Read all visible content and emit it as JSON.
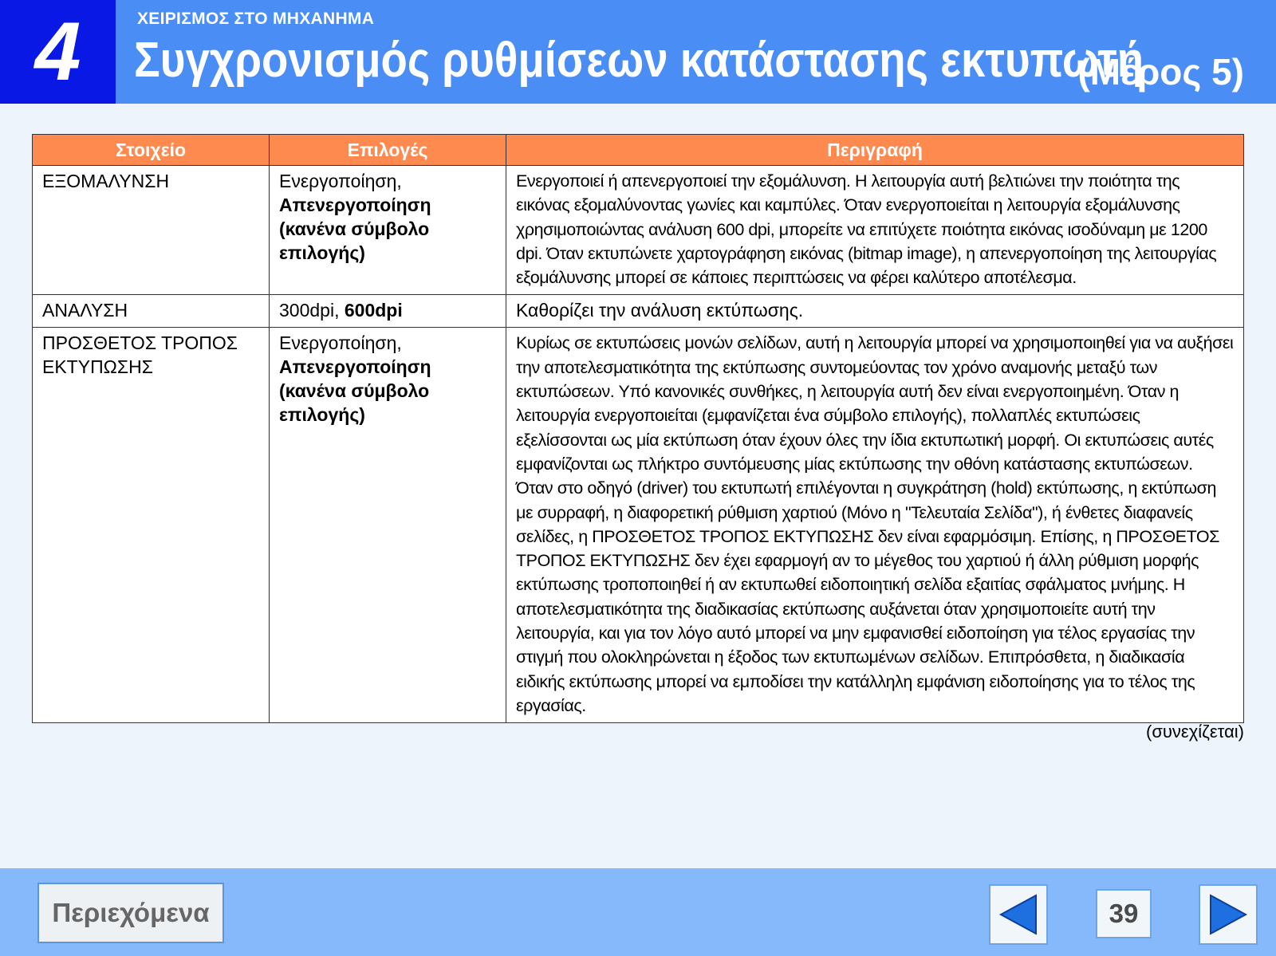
{
  "header": {
    "chapter_number": "4",
    "section_label": "ΧΕΙΡΙΣΜΟΣ ΣΤΟ ΜΗΧΑΝΗΜΑ",
    "title": "Συγχρονισμός ρυθμίσεων κατάστασης εκτυπωτή",
    "title_part": "(Μέρος 5)"
  },
  "table": {
    "headers": [
      "Στοιχείο",
      "Επιλογές",
      "Περιγραφή"
    ],
    "rows": [
      {
        "item": "ΕΞΟΜΑΛΥΝΣΗ",
        "options_plain": "Ενεργοποίηση,",
        "options_bold": "Απενεργοποίηση (κανένα σύμβολο επιλογής)",
        "description": "Ενεργοποιεί ή απενεργοποιεί την εξομάλυνση. Η λειτουργία αυτή βελτιώνει την ποιότητα της εικόνας εξομαλύνοντας γωνίες και καμπύλες. Όταν ενεργοποιείται η λειτουργία εξομάλυνσης χρησιμοποιώντας ανάλυση 600 dpi, μπορείτε να επιτύχετε ποιότητα εικόνας ισοδύναμη με 1200 dpi.  Όταν εκτυπώνετε χαρτογράφηση εικόνας (bitmap image), η απενεργοποίηση της λειτουργίας εξομάλυνσης μπορεί σε κάποιες περιπτώσεις να φέρει καλύτερο αποτέλεσμα."
      },
      {
        "item": "ΑΝΑΛΥΣΗ",
        "options_plain": "300dpi, ",
        "options_bold": "600dpi",
        "description": "Καθορίζει την ανάλυση εκτύπωσης."
      },
      {
        "item": "ΠΡΟΣΘΕΤΟΣ ΤΡΟΠΟΣ ΕΚΤΥΠΩΣΗΣ",
        "options_plain": "Ενεργοποίηση,",
        "options_bold": "Απενεργοποίηση (κανένα σύμβολο επιλογής)",
        "description": "Κυρίως σε εκτυπώσεις μονών σελίδων, αυτή η λειτουργία μπορεί να χρησιμοποιηθεί για να αυξήσει την αποτελεσματικότητα της εκτύπωσης συντομεύοντας τον χρόνο αναμονής μεταξύ των εκτυπώσεων. Υπό κανονικές συνθήκες, η λειτουργία αυτή δεν είναι ενεργοποιημένη. Όταν η λειτουργία ενεργοποιείται (εμφανίζεται ένα σύμβολο επιλογής), πολλαπλές εκτυπώσεις εξελίσσονται ως μία εκτύπωση όταν έχουν όλες την ίδια εκτυπωτική μορφή. Οι εκτυπώσεις αυτές εμφανίζονται ως πλήκτρο συντόμευσης μίας εκτύπωσης την οθόνη κατάστασης εκτυπώσεων. Όταν στο οδηγό (driver) του εκτυπωτή επιλέγονται η συγκράτηση (hold) εκτύπωσης, η εκτύπωση με συρραφή, η διαφορετική ρύθμιση χαρτιού (Μόνο η \"Τελευταία Σελίδα\"), ή ένθετες διαφανείς σελίδες, η ΠΡΟΣΘΕΤΟΣ ΤΡΟΠΟΣ ΕΚΤΥΠΩΣΗΣ δεν είναι εφαρμόσιμη. Επίσης, η ΠΡΟΣΘΕΤΟΣ ΤΡΟΠΟΣ ΕΚΤΥΠΩΣΗΣ δεν έχει εφαρμογή αν το μέγεθος του χαρτιού ή άλλη ρύθμιση μορφής εκτύπωσης τροποποιηθεί ή αν εκτυπωθεί ειδοποιητική σελίδα εξαιτίας σφάλματος μνήμης. Η αποτελεσματικότητα της διαδικασίας εκτύπωσης αυξάνεται όταν χρησιμοποιείτε αυτή την λειτουργία, και για τον λόγο αυτό μπορεί να μην εμφανισθεί ειδοποίηση για τέλος εργασίας την στιγμή που ολοκληρώνεται η έξοδος των εκτυπωμένων σελίδων. Επιπρόσθετα, η διαδικασία ειδικής εκτύπωσης μπορεί να εμποδίσει την κατάλληλη εμφάνιση ειδοποίησης για το τέλος της εργασίας."
      }
    ]
  },
  "continued_label": "(συνεχίζεται)",
  "footer": {
    "contents_button": "Περιεχόμενα",
    "page_number": "39",
    "prev_icon": "triangle-left",
    "next_icon": "triangle-right"
  },
  "colors": {
    "header_bg": "#4a8ef5",
    "chapter_bg": "#0a18e6",
    "table_header_bg": "#ff8a50",
    "footer_bg": "#86b8fc",
    "nav_arrow": "#1e6fe0"
  }
}
